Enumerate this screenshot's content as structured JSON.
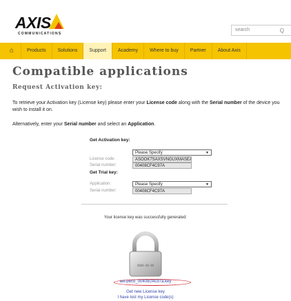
{
  "brand": {
    "logo_text": "AXIS",
    "logo_sub": "COMMUNICATIONS"
  },
  "search": {
    "placeholder": "search"
  },
  "nav": {
    "home_icon": "home-icon",
    "items": [
      "Products",
      "Solutions",
      "Support",
      "Academy",
      "Where to buy",
      "Partner",
      "About Axis"
    ],
    "active": "Support"
  },
  "page": {
    "title": "Compatible applications",
    "subtitle": "Request Activation key:",
    "para1_a": "To retrieve your Activation key (License key) please enter your ",
    "para1_b": "License code",
    "para1_c": " along with the ",
    "para1_d": "Serial number",
    "para1_e": " of the device you wish to install it on.",
    "para2_a": "Alternatively, enter your ",
    "para2_b": "Serial number",
    "para2_c": " and select an ",
    "para2_d": "Application",
    "para2_e": "."
  },
  "form": {
    "activation_heading": "Get Activation key:",
    "activation_select": "Please Specify",
    "license_label": "License code:",
    "license_value": "ASOOK7SAXSVNGUXMASEA",
    "serial_label": "Serial number:",
    "serial_value": "00408CF4C97A",
    "trial_heading": "Get Trial key:",
    "application_label": "Application:",
    "application_select": "Please Specify",
    "serial2_label": "Serial number:",
    "serial2_value": "00408CF4C97A"
  },
  "result": {
    "success_text": "Your license key was successfully generated:",
    "padlock_text": "XXXX-XX-XX",
    "key_file": "axi-peco_00408cf4c97a.key",
    "link_new": "Get new License key",
    "link_lost": "I have lost my License code(s)"
  },
  "colors": {
    "accent": "#f5c300",
    "link": "#3344aa",
    "highlight": "#d0303a"
  }
}
